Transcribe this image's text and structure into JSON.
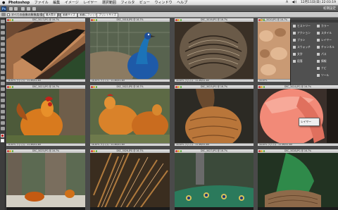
{
  "menubar": {
    "app_name": "Photoshop",
    "items": [
      "ファイル",
      "編集",
      "イメージ",
      "レイヤー",
      "選択範囲",
      "フィルタ",
      "ビュー",
      "ウィンドウ",
      "ヘルプ"
    ],
    "clock": "12月11日(日) 22:03:19",
    "status_items": [
      "A",
      "◀))"
    ]
  },
  "appbar": {
    "app_icon": "Ps",
    "workspace": "初期設定"
  },
  "optbar": {
    "checkbox_label": "すべての画像の解像度/重ね順を自動選択",
    "buttons": [
      "最大表示",
      "画面サイズ",
      "画面にフィット",
      "プリントサイズ"
    ]
  },
  "windows": [
    {
      "title": "DSC_5017.JPG @ 16.7%",
      "status": "16.67%  ファイル : 11.4M/11.4M"
    },
    {
      "title": "DSC_5018.JPG @ 16.7%",
      "status": "16.67%  ファイル : 11.4M/11.4M"
    },
    {
      "title": "DSC_5019.JPG @ 16.7%",
      "status": "16.67%  ファイル : 11.4M/11.4M"
    },
    {
      "title": "DSC_5020.JPG @ 16.7%",
      "status": "16.67%"
    },
    {
      "title": "DSC_5021.JPG @ 16.7%",
      "status": "16.67%  ファイル : 11.4M/11.4M"
    },
    {
      "title": "DSC_5022.JPG @ 16.7%",
      "status": "16.67%  ファイル : 11.4M/11.4M"
    },
    {
      "title": "DSC_5023.JPG @ 16.7%",
      "status": "16.67%  ファイル : 11.4M/11.4M"
    },
    {
      "title": "DSC_5024.JPG @ 16.7%",
      "status": "16.67%  ファイル : 11.4M/11.4M"
    },
    {
      "title": "DSC_5025.JPG @ 16.7%",
      "status": "16.67%"
    },
    {
      "title": "DSC_5026.JPG @ 16.7%",
      "status": "16.67%"
    },
    {
      "title": "DSC_5027.JPG @ 16.7%",
      "status": "16.67%"
    },
    {
      "title": "DSC_5028.JPG @ 16.7%",
      "status": "16.67%  ファイル : 11.4M/11.4M"
    }
  ],
  "panel": {
    "left_items": [
      "ヒストリー",
      "アクション",
      "ブラシ",
      "スウォッチ",
      "文字",
      "段落"
    ],
    "right_items": [
      "カラー",
      "スタイル",
      "レイヤー",
      "チャンネル",
      "パス",
      "情報",
      "ナビ",
      "ツール"
    ]
  },
  "context_menu": {
    "item": "レイヤー"
  },
  "icons": {
    "apple": "apple-logo-icon",
    "ps": "photoshop-app-icon",
    "tool": "move-tool-icon"
  }
}
